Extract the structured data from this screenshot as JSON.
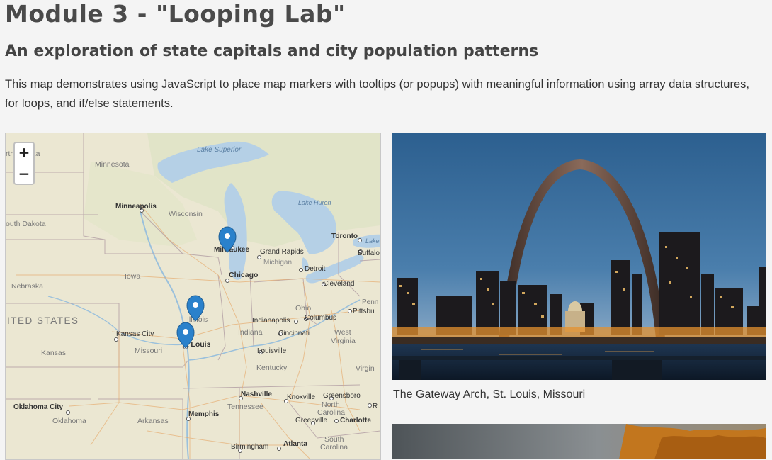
{
  "header": {
    "title": "Module 3 - \"Looping Lab\"",
    "subtitle": "An exploration of state capitals and city population patterns",
    "description": "This map demonstrates using JavaScript to place map markers with tooltips (or popups) with meaningful information using array data structures, for loops, and if/else statements."
  },
  "map": {
    "zoom_in_label": "+",
    "zoom_out_label": "−",
    "labels": {
      "lake_superior": "Lake Superior",
      "lake_huron": "Lake Huron",
      "lake_michigan": "Michigan",
      "north_dakota": "rth Dakota",
      "minnesota": "Minnesota",
      "south_dakota": "outh Dakota",
      "minneapolis": "Minneapolis",
      "wisconsin": "Wisconsin",
      "iowa": "Iowa",
      "nebraska": "Nebraska",
      "united_states": "ITED STATES",
      "kansas_city": "Kansas City",
      "kansas": "Kansas",
      "missouri": "Missouri",
      "st_louis": "t Louis",
      "illinois": "Illinois",
      "milwaukee": "Milwaukee",
      "grand_rapids": "Grand Rapids",
      "chicago": "Chicago",
      "detroit": "Detroit",
      "toronto": "Toronto",
      "lake_ontario": "Lake",
      "buffalo": "Buffalo",
      "cleveland": "Cleveland",
      "ohio": "Ohio",
      "columbus": "Columbus",
      "pittsburgh": "Pittsbu",
      "penn": "Penn",
      "indianapolis": "Indianapolis",
      "indiana": "Indiana",
      "cincinnati": "Cincinnati",
      "west_virginia_1": "West",
      "west_virginia_2": "Virginia",
      "virgin": "Virgin",
      "louisville": "Louisville",
      "kentucky": "Kentucky",
      "oklahoma_city": "Oklahoma City",
      "oklahoma": "Oklahoma",
      "arkansas": "Arkansas",
      "memphis": "Memphis",
      "nashville": "Nashville",
      "tennessee": "Tennessee",
      "knoxville": "Knoxville",
      "greensboro": "Greensboro",
      "north_carolina_1": "North",
      "north_carolina_2": "Carolina",
      "charlotte": "Charlotte",
      "greenville": "Greenville",
      "r_edge": "R",
      "birmingham": "Birmingham",
      "atlanta": "Atlanta",
      "south_carolina_1": "South",
      "south_carolina_2": "Carolina"
    },
    "marker_color": "#2a81cb"
  },
  "photo": {
    "caption": "The Gateway Arch, St. Louis, Missouri"
  }
}
